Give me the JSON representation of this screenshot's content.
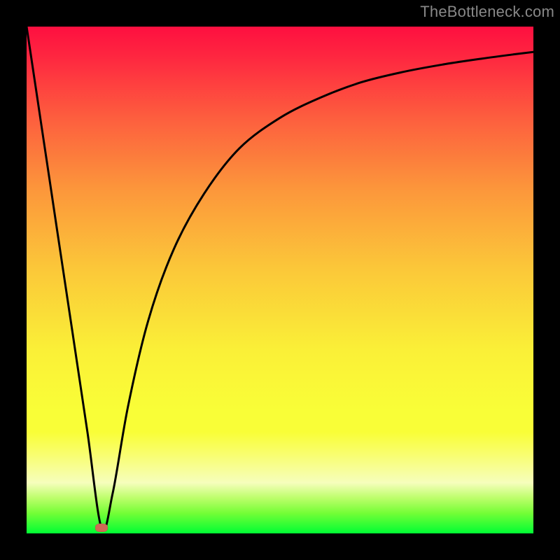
{
  "watermark": "TheBottleneck.com",
  "colors": {
    "frame_background": "#000000",
    "curve": "#000000",
    "marker": "#cf6a55",
    "gradient_stops": [
      "#fe0f40",
      "#fd5e3e",
      "#fbc839",
      "#f9fe37",
      "#74fe36",
      "#00fe34"
    ]
  },
  "chart_data": {
    "type": "line",
    "title": "",
    "xlabel": "",
    "ylabel": "",
    "xlim": [
      0,
      100
    ],
    "ylim": [
      0,
      100
    ],
    "grid": false,
    "legend": false,
    "annotations": [],
    "series": [
      {
        "name": "bottleneck-curve",
        "x": [
          0,
          3,
          6,
          9,
          12,
          14.8,
          17,
          20,
          24,
          29,
          35,
          42,
          50,
          58,
          66,
          74,
          82,
          90,
          96,
          100
        ],
        "values": [
          100,
          80,
          60,
          40,
          20,
          1,
          8,
          25,
          42,
          56,
          67,
          76,
          82,
          86,
          89,
          91,
          92.5,
          93.7,
          94.5,
          95
        ]
      }
    ],
    "marker": {
      "x_percent": 14.8,
      "y_percent": 1
    }
  }
}
